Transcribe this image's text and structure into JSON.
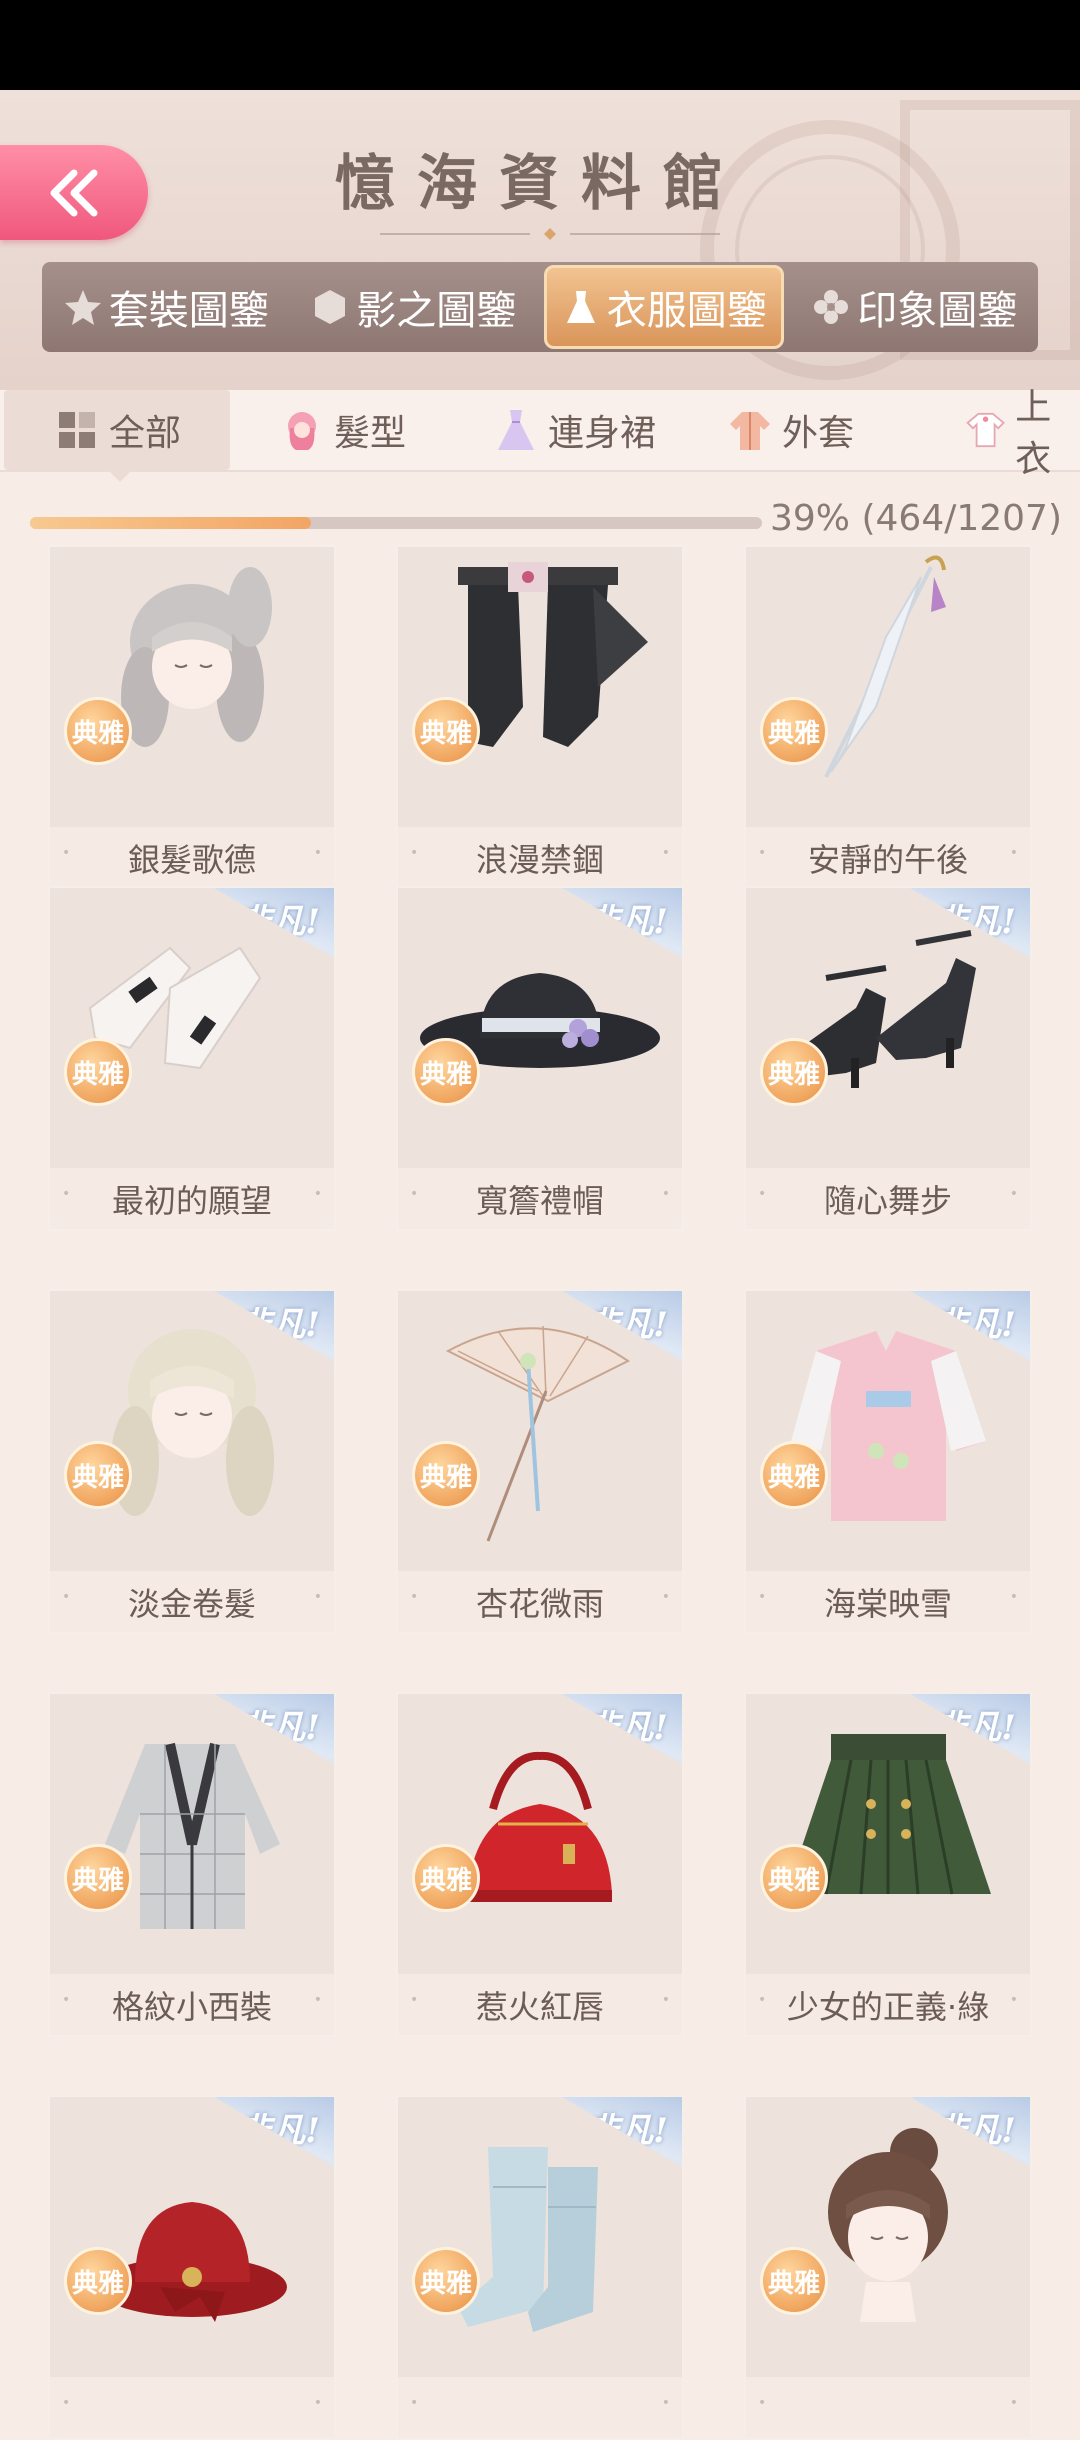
{
  "header": {
    "title": "憶海資料館"
  },
  "category_tabs": [
    {
      "label": "套裝圖鑒",
      "icon": "star-icon"
    },
    {
      "label": "影之圖鑒",
      "icon": "shadow-icon"
    },
    {
      "label": "衣服圖鑒",
      "icon": "dress-icon",
      "active": true
    },
    {
      "label": "印象圖鑒",
      "icon": "flower-icon"
    }
  ],
  "sub_tabs": [
    {
      "label": "全部",
      "icon": "grid-icon",
      "active": true
    },
    {
      "label": "髮型",
      "icon": "hair-icon"
    },
    {
      "label": "連身裙",
      "icon": "dress-icon"
    },
    {
      "label": "外套",
      "icon": "coat-icon"
    },
    {
      "label": "上衣",
      "icon": "shirt-icon"
    }
  ],
  "progress": {
    "text": "39% (464/1207)",
    "fraction": 0.384
  },
  "badge_label": "典雅",
  "rarity_label": "非凡!",
  "items": [
    {
      "name": "銀髮歌德",
      "art": "silver-hair"
    },
    {
      "name": "浪漫禁錮",
      "art": "black-stockings"
    },
    {
      "name": "安靜的午後",
      "art": "white-umbrella"
    },
    {
      "name": "最初的願望",
      "art": "white-gloves",
      "rarity": true
    },
    {
      "name": "寬簷禮帽",
      "art": "black-hat",
      "rarity": true
    },
    {
      "name": "隨心舞步",
      "art": "black-heels",
      "rarity": true
    },
    {
      "name": "淡金卷髮",
      "art": "blonde-hair",
      "rarity": true
    },
    {
      "name": "杏花微雨",
      "art": "parasol",
      "rarity": true
    },
    {
      "name": "海棠映雪",
      "art": "pink-robe",
      "rarity": true
    },
    {
      "name": "格紋小西裝",
      "art": "plaid-jacket",
      "rarity": true
    },
    {
      "name": "惹火紅唇",
      "art": "red-handbag",
      "rarity": true
    },
    {
      "name": "少女的正義·綠",
      "art": "green-skirt",
      "rarity": true
    },
    {
      "name": "",
      "art": "red-hat",
      "rarity": true
    },
    {
      "name": "",
      "art": "blue-boots",
      "rarity": true
    },
    {
      "name": "",
      "art": "brown-bun-hair",
      "rarity": true
    }
  ],
  "colors": {
    "accent": "#f0577d",
    "active_tab": "#e0a064",
    "panel": "#ede2dc"
  }
}
